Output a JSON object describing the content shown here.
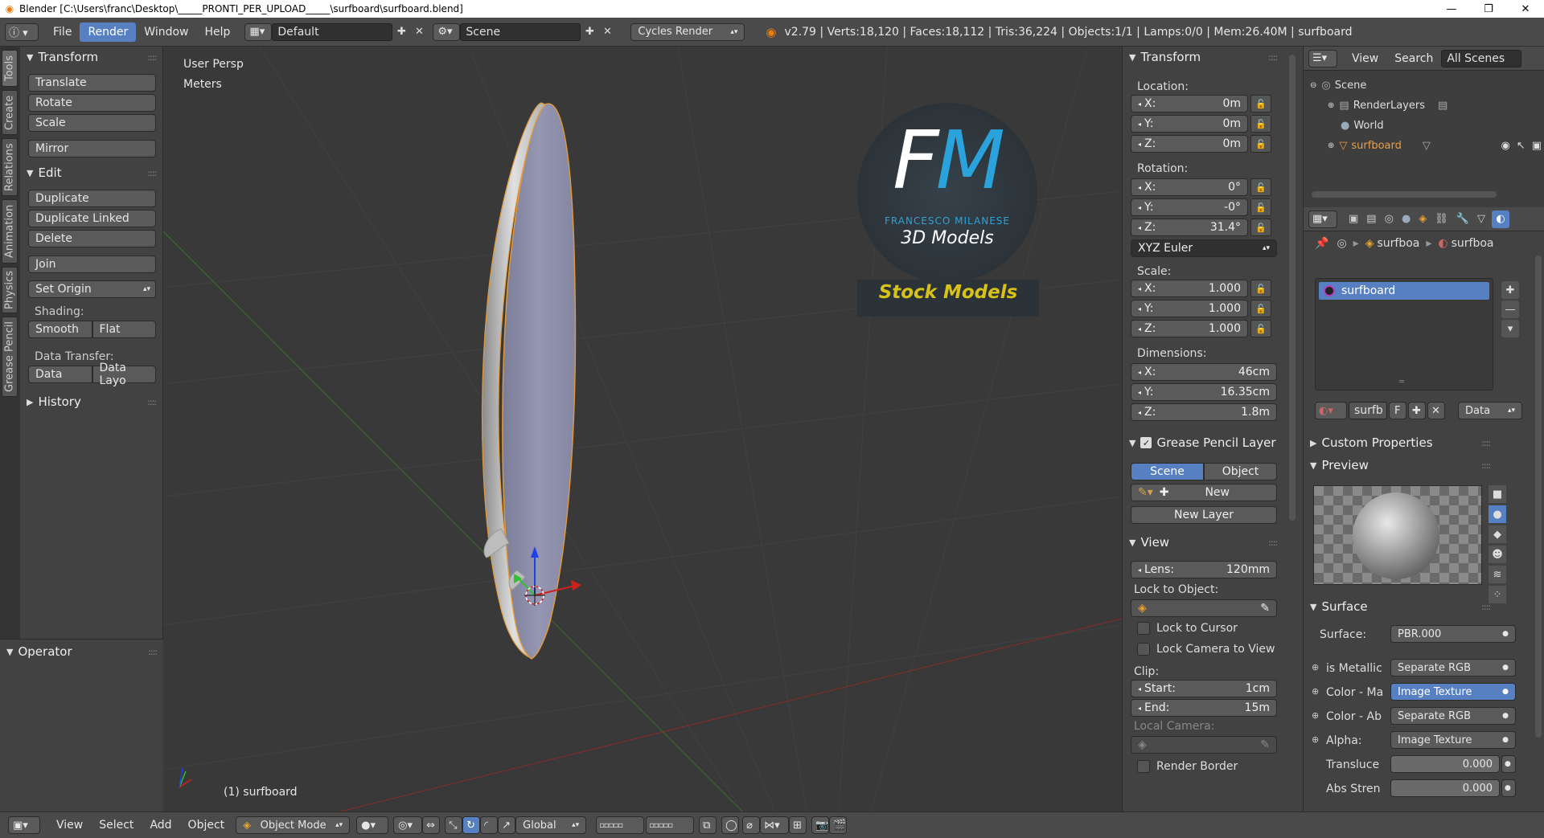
{
  "window": {
    "title": "Blender [C:\\Users\\franc\\Desktop\\_____PRONTI_PER_UPLOAD_____\\surfboard\\surfboard.blend]",
    "minimize": "—",
    "maximize": "❐",
    "close": "✕"
  },
  "infobar": {
    "menus": [
      "File",
      "Render",
      "Window",
      "Help"
    ],
    "active_menu": "Render",
    "layout": "Default",
    "scene": "Scene",
    "engine": "Cycles Render",
    "stats": "v2.79 | Verts:18,120 | Faces:18,112 | Tris:36,224 | Objects:1/1 | Lamps:0/0 | Mem:26.40M | surfboard"
  },
  "left_tabs": [
    "Tools",
    "Create",
    "Relations",
    "Animation",
    "Physics",
    "Grease Pencil"
  ],
  "toolshelf": {
    "transform_header": "Transform",
    "translate": "Translate",
    "rotate": "Rotate",
    "scale": "Scale",
    "mirror": "Mirror",
    "edit_header": "Edit",
    "duplicate": "Duplicate",
    "duplicate_linked": "Duplicate Linked",
    "delete": "Delete",
    "join": "Join",
    "set_origin": "Set Origin",
    "shading_label": "Shading:",
    "smooth": "Smooth",
    "flat": "Flat",
    "data_transfer_label": "Data Transfer:",
    "data": "Data",
    "data_layout": "Data Layo",
    "history_header": "History"
  },
  "operator": {
    "header": "Operator"
  },
  "viewport": {
    "view_name": "User Persp",
    "units": "Meters",
    "object_label": "(1) surfboard",
    "logo": {
      "letters": "FM",
      "name": "FRANCESCO MILANESE",
      "sub": "3D Models",
      "banner": "Stock Models"
    }
  },
  "npanel": {
    "transform_header": "Transform",
    "location_label": "Location:",
    "loc_x": "0m",
    "loc_y": "0m",
    "loc_z": "0m",
    "rotation_label": "Rotation:",
    "rot_x": "0°",
    "rot_y": "-0°",
    "rot_z": "31.4°",
    "rot_mode": "XYZ Euler",
    "scale_label": "Scale:",
    "scale_x": "1.000",
    "scale_y": "1.000",
    "scale_z": "1.000",
    "dimensions_label": "Dimensions:",
    "dim_x": "46cm",
    "dim_y": "16.35cm",
    "dim_z": "1.8m",
    "axis_x": "X:",
    "axis_y": "Y:",
    "axis_z": "Z:",
    "gp_header": "Grease Pencil Layer",
    "gp_scene": "Scene",
    "gp_object": "Object",
    "gp_new": "New",
    "gp_new_layer": "New Layer",
    "view_header": "View",
    "lens_label": "Lens:",
    "lens_value": "120mm",
    "lock_object_label": "Lock to Object:",
    "lock_cursor": "Lock to Cursor",
    "lock_camera": "Lock Camera to View",
    "clip_label": "Clip:",
    "clip_start_label": "Start:",
    "clip_start": "1cm",
    "clip_end_label": "End:",
    "clip_end": "15m",
    "local_camera_label": "Local Camera:",
    "render_border": "Render Border"
  },
  "outliner": {
    "view": "View",
    "search": "Search",
    "filter": "All Scenes",
    "items": [
      "Scene",
      "RenderLayers",
      "World",
      "surfboard"
    ]
  },
  "properties": {
    "crumb1": "surfboa",
    "crumb2": "surfboa",
    "slot": "surfboard",
    "mat_name": "surfb",
    "mat_f": "F",
    "mat_link": "Data",
    "custom_props": "Custom Properties",
    "preview": "Preview",
    "surface_header": "Surface",
    "surface_label": "Surface:",
    "surface_value": "PBR.000",
    "rows": [
      {
        "label": "is Metallic",
        "value": "Separate RGB"
      },
      {
        "label": "Color - Ma",
        "value": "Image Texture"
      },
      {
        "label": "Color - Ab",
        "value": "Separate RGB"
      },
      {
        "label": "Alpha:",
        "value": "Image Texture"
      }
    ],
    "translucency_label": "Transluce",
    "translucency_value": "0.000",
    "abs_label": "Abs Stren",
    "abs_value": "0.000"
  },
  "bottombar": {
    "view": "View",
    "select": "Select",
    "add": "Add",
    "object": "Object",
    "mode": "Object Mode",
    "orientation": "Global"
  },
  "colors": {
    "accent": "#5680c2",
    "board": "#8a8ca8",
    "logo_blue": "#2aa3dc",
    "logo_yellow": "#d6c21a",
    "logo_bg": "#2c3338"
  }
}
